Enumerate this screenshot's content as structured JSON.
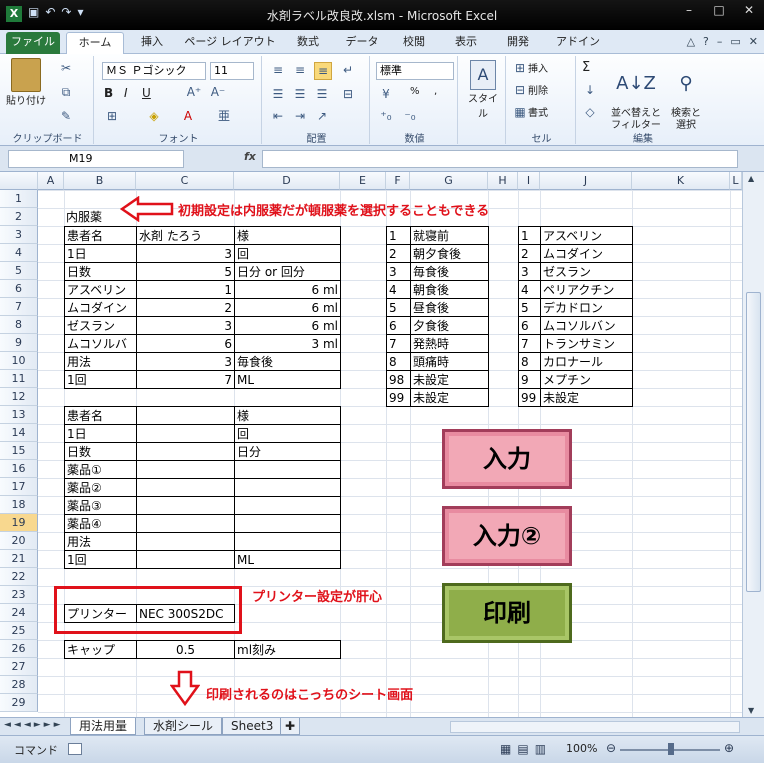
{
  "window": {
    "title": "水剤ラベル改良改.xlsm  -  Microsoft Excel",
    "app_icon": "X"
  },
  "ribbon_tabs": [
    "ファイル",
    "ホーム",
    "挿入",
    "ページ レイアウト",
    "数式",
    "データ",
    "校閲",
    "表示",
    "開発",
    "アドイン"
  ],
  "ribbon": {
    "clipboard": {
      "paste_label": "貼り付け",
      "group_label": "クリップボード"
    },
    "font": {
      "font_name": "ＭＳ Ｐゴシック",
      "font_size": "11",
      "group_label": "フォント",
      "bold": "B",
      "italic": "I",
      "underline": "U"
    },
    "alignment": {
      "group_label": "配置"
    },
    "number": {
      "format": "標準",
      "group_label": "数値",
      "percent": "%",
      "comma": ","
    },
    "style": {
      "label": "スタイル"
    },
    "cells": {
      "insert": "挿入",
      "delete": "削除",
      "format": "書式",
      "group_label": "セル"
    },
    "editing": {
      "sort_label": "並べ替えと\nフィルター",
      "find_label": "検索と\n選択",
      "group_label": "編集",
      "sum": "Σ"
    }
  },
  "formula_bar": {
    "name_box": "M19",
    "fx": "fx",
    "value": ""
  },
  "columns": [
    "A",
    "B",
    "C",
    "D",
    "E",
    "F",
    "G",
    "H",
    "I",
    "J",
    "K",
    "L"
  ],
  "rows": [
    "1",
    "2",
    "3",
    "4",
    "5",
    "6",
    "7",
    "8",
    "9",
    "10",
    "11",
    "12",
    "13",
    "14",
    "15",
    "16",
    "17",
    "18",
    "19",
    "20",
    "21",
    "22",
    "23",
    "24",
    "25",
    "26",
    "27",
    "28",
    "29"
  ],
  "selected_row": "19",
  "cells": {
    "b2": "内服薬",
    "b3": "患者名",
    "c3": "水剤  たろう",
    "d3": "様",
    "b4": "1日",
    "c4": "3",
    "d4": "回",
    "b5": "日数",
    "c5": "5",
    "d5": "日分  or  回分",
    "b6": "アスベリン",
    "c6": "1",
    "d6": "6 ml",
    "b7": "ムコダイン",
    "c7": "2",
    "d7": "6 ml",
    "b8": "ゼスラン",
    "c8": "3",
    "d8": "6 ml",
    "b9": "ムコソルバ",
    "c9": "6",
    "d9": "3 ml",
    "b10": "用法",
    "c10": "3",
    "d10": "毎食後",
    "b11": "1回",
    "c11": "7",
    "d11": "ML",
    "b13": "患者名",
    "d13": "様",
    "b14": "1日",
    "d14": "回",
    "b15": "日数",
    "d15": "日分",
    "b16": "薬品①",
    "b17": "薬品②",
    "b18": "薬品③",
    "b19": "薬品④",
    "b20": "用法",
    "b21": "1回",
    "d21": "ML",
    "b24": "プリンター",
    "c24": "NEC 300S2DC",
    "b26": "キャップ",
    "c26": "0.5",
    "d26": "ml刻み"
  },
  "timing_table": [
    [
      "1",
      "就寝前"
    ],
    [
      "2",
      "朝夕食後"
    ],
    [
      "3",
      "毎食後"
    ],
    [
      "4",
      "朝食後"
    ],
    [
      "5",
      "昼食後"
    ],
    [
      "6",
      "夕食後"
    ],
    [
      "7",
      "発熱時"
    ],
    [
      "8",
      "頭痛時"
    ],
    [
      "98",
      "未設定"
    ],
    [
      "99",
      "未設定"
    ]
  ],
  "drug_table": [
    [
      "1",
      "アスベリン"
    ],
    [
      "2",
      "ムコダイン"
    ],
    [
      "3",
      "ゼスラン"
    ],
    [
      "4",
      "ペリアクチン"
    ],
    [
      "5",
      "デカドロン"
    ],
    [
      "6",
      "ムコソルバン"
    ],
    [
      "7",
      "トランサミン"
    ],
    [
      "8",
      "カロナール"
    ],
    [
      "9",
      "メプチン"
    ],
    [
      "99",
      "未設定"
    ]
  ],
  "buttons": {
    "input1": "入力",
    "input2": "入力②",
    "print": "印刷"
  },
  "annotations": {
    "top": "初期設定は内服薬だが頓服薬を選択することもできる",
    "printer": "プリンター設定が肝心",
    "bottom": "印刷されるのはこっちのシート画面"
  },
  "sheet_tabs": [
    "用法用量",
    "水剤シール",
    "Sheet3"
  ],
  "status": {
    "mode": "コマンド",
    "zoom": "100%"
  },
  "colors": {
    "accent_red": "#e0111a",
    "button_pink": "#f2a8b6",
    "button_green": "#8fae4a",
    "selected_row": "#f8d88f"
  }
}
